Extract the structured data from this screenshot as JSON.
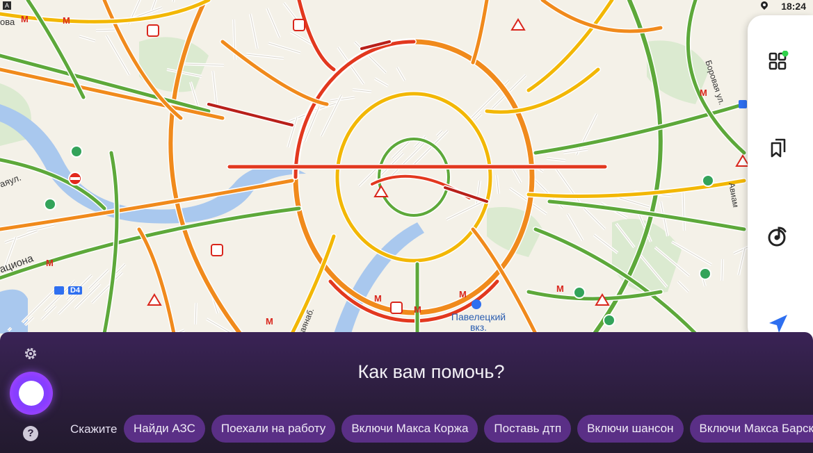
{
  "status": {
    "time": "18:24",
    "left_badge": "A"
  },
  "map": {
    "labels": {
      "station": "Павелецкий вкз.",
      "street_left_top": "ова",
      "street_left_mid": "аяул.",
      "street_left_bottom": "ационa",
      "street_top_right": "Боровая ул.",
      "street_right": "Авиам",
      "street_bottom": "каянаб.",
      "d4": "D4"
    },
    "colors": {
      "green": "#5da83a",
      "yellow": "#f2b705",
      "orange": "#f08a1c",
      "red": "#e2381f",
      "darkred": "#b8201a"
    }
  },
  "rail": {
    "icons": [
      "widgets-icon",
      "bookmarks-icon",
      "music-icon",
      "navigation-arrow-icon"
    ],
    "accent": "#2e6ff0"
  },
  "assistant": {
    "prompt": "Как вам помочь?",
    "say_label": "Скажите",
    "suggestions": [
      "Найди АЗС",
      "Поехали на работу",
      "Включи Макса Коржа",
      "Поставь дтп",
      "Включи шансон",
      "Включи Макса Барски"
    ]
  }
}
